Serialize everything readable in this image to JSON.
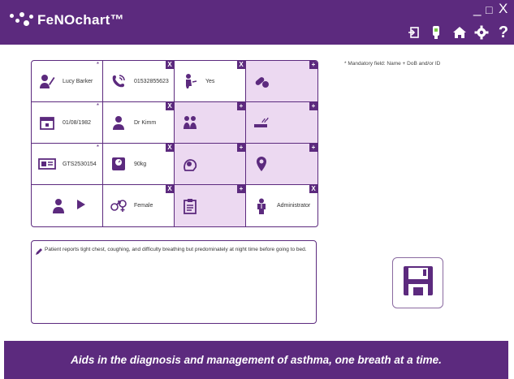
{
  "app": {
    "title": "FeNOchart™"
  },
  "window": {
    "minimize": "_",
    "maximize": "□",
    "close": "X"
  },
  "toolbar": {
    "icons": [
      "logout-icon",
      "device-icon",
      "home-icon",
      "settings-icon",
      "help-icon"
    ],
    "help_label": "?"
  },
  "colors": {
    "primary": "#5c2a7e",
    "cell_highlight": "#ecd9f1"
  },
  "patient_grid": {
    "name": "Lucy Barker",
    "phone": "01532855623",
    "consent": "Yes",
    "dob": "01/08/1982",
    "doctor": "Dr Kimm",
    "id": "GTS2530154",
    "weight": "90kg",
    "gender": "Female",
    "role": "Administrator",
    "badge_remove": "X",
    "badge_add": "+",
    "required_mark": "*"
  },
  "mandatory_note": "* Mandatory field: Name + DoB and/or ID",
  "notes": {
    "text": "Patient reports tight chest, coughing, and difficulty breathing but predominately at night time before going to bed."
  },
  "footer": {
    "tagline": "Aids in the diagnosis and management of asthma, one breath at a time."
  }
}
